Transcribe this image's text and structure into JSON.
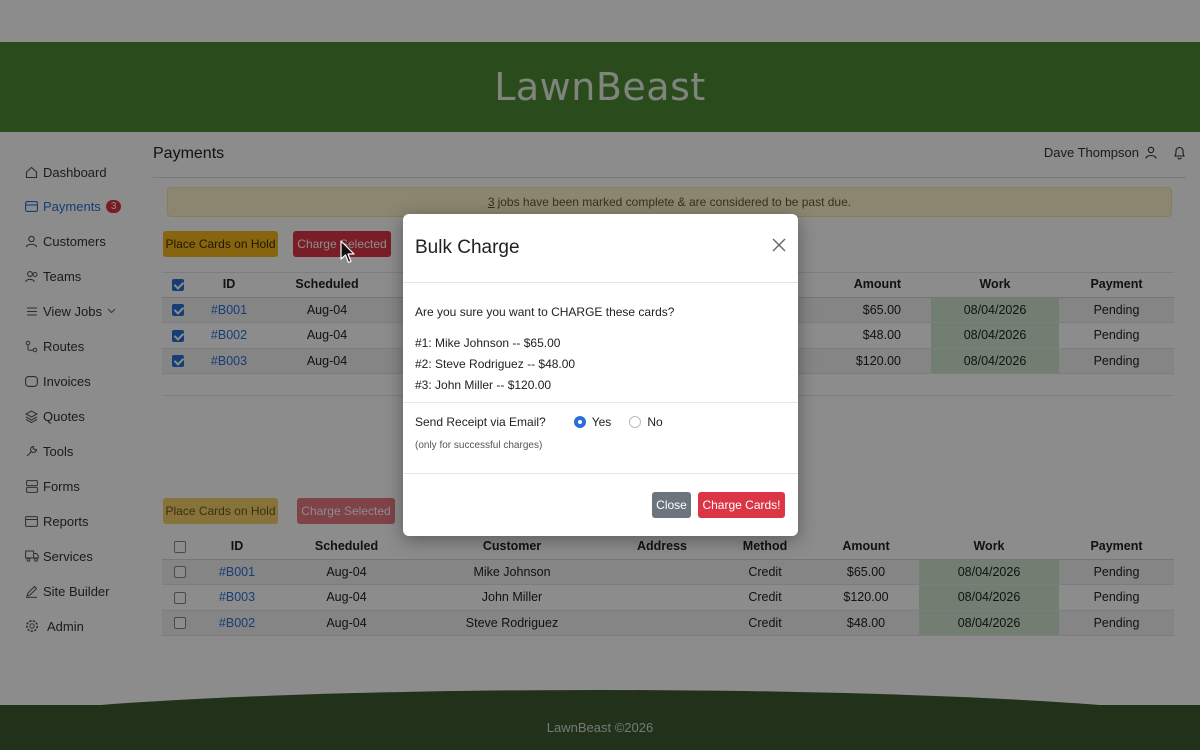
{
  "app": {
    "brand": "LawnBeast",
    "footer": "LawnBeast ©2026"
  },
  "sidebar": {
    "items": [
      {
        "label": "Dashboard",
        "icon": "home-icon"
      },
      {
        "label": "Payments",
        "icon": "card-icon",
        "badge": "3",
        "active": true
      },
      {
        "label": "Customers",
        "icon": "user-icon"
      },
      {
        "label": "Teams",
        "icon": "users-icon"
      },
      {
        "label": "View Jobs",
        "icon": "list-icon"
      },
      {
        "label": "Routes",
        "icon": "route-icon"
      },
      {
        "label": "Invoices",
        "icon": "invoice-icon"
      },
      {
        "label": "Quotes",
        "icon": "layers-icon"
      },
      {
        "label": "Tools",
        "icon": "wrench-icon"
      },
      {
        "label": "Forms",
        "icon": "forms-icon"
      },
      {
        "label": "Reports",
        "icon": "reports-icon"
      },
      {
        "label": "Services",
        "icon": "truck-icon"
      },
      {
        "label": "Site Builder",
        "icon": "pencil-icon"
      },
      {
        "label": "Admin",
        "icon": "gear-icon"
      }
    ]
  },
  "header": {
    "title": "Payments",
    "user": "Dave Thompson"
  },
  "alert": {
    "count": "3",
    "text": "jobs have been marked complete & are considered to be past due."
  },
  "actions": {
    "hold": "Place Cards on Hold",
    "charge": "Charge Selected"
  },
  "table1": {
    "headers": [
      "ID",
      "Scheduled",
      "Amount",
      "Work",
      "Payment"
    ],
    "rows": [
      {
        "id": "#B001",
        "scheduled": "Aug-04",
        "amount": "$65.00",
        "work": "08/04/2026",
        "payment": "Pending"
      },
      {
        "id": "#B002",
        "scheduled": "Aug-04",
        "amount": "$48.00",
        "work": "08/04/2026",
        "payment": "Pending"
      },
      {
        "id": "#B003",
        "scheduled": "Aug-04",
        "amount": "$120.00",
        "work": "08/04/2026",
        "payment": "Pending"
      }
    ]
  },
  "table2": {
    "headers": [
      "ID",
      "Scheduled",
      "Customer",
      "Address",
      "Method",
      "Amount",
      "Work",
      "Payment"
    ],
    "rows": [
      {
        "id": "#B001",
        "scheduled": "Aug-04",
        "customer": "Mike Johnson",
        "address": "",
        "method": "Credit",
        "amount": "$65.00",
        "work": "08/04/2026",
        "payment": "Pending"
      },
      {
        "id": "#B003",
        "scheduled": "Aug-04",
        "customer": "John Miller",
        "address": "",
        "method": "Credit",
        "amount": "$120.00",
        "work": "08/04/2026",
        "payment": "Pending"
      },
      {
        "id": "#B002",
        "scheduled": "Aug-04",
        "customer": "Steve Rodriguez",
        "address": "",
        "method": "Credit",
        "amount": "$48.00",
        "work": "08/04/2026",
        "payment": "Pending"
      }
    ]
  },
  "modal": {
    "title": "Bulk Charge",
    "question": "Are you sure you want to CHARGE these cards?",
    "items": [
      "#1: Mike Johnson -- $65.00",
      "#2: Steve Rodriguez -- $48.00",
      "#3: John Miller -- $120.00"
    ],
    "receipt_label": "Send Receipt via Email?",
    "yes": "Yes",
    "no": "No",
    "note": "(only for successful charges)",
    "close": "Close",
    "confirm": "Charge Cards!"
  },
  "colors": {
    "brand_green": "#4e8a36",
    "footer_green": "#3c5a30",
    "danger": "#dc3545",
    "warning": "#f4b81b",
    "link": "#2b6fd6"
  }
}
